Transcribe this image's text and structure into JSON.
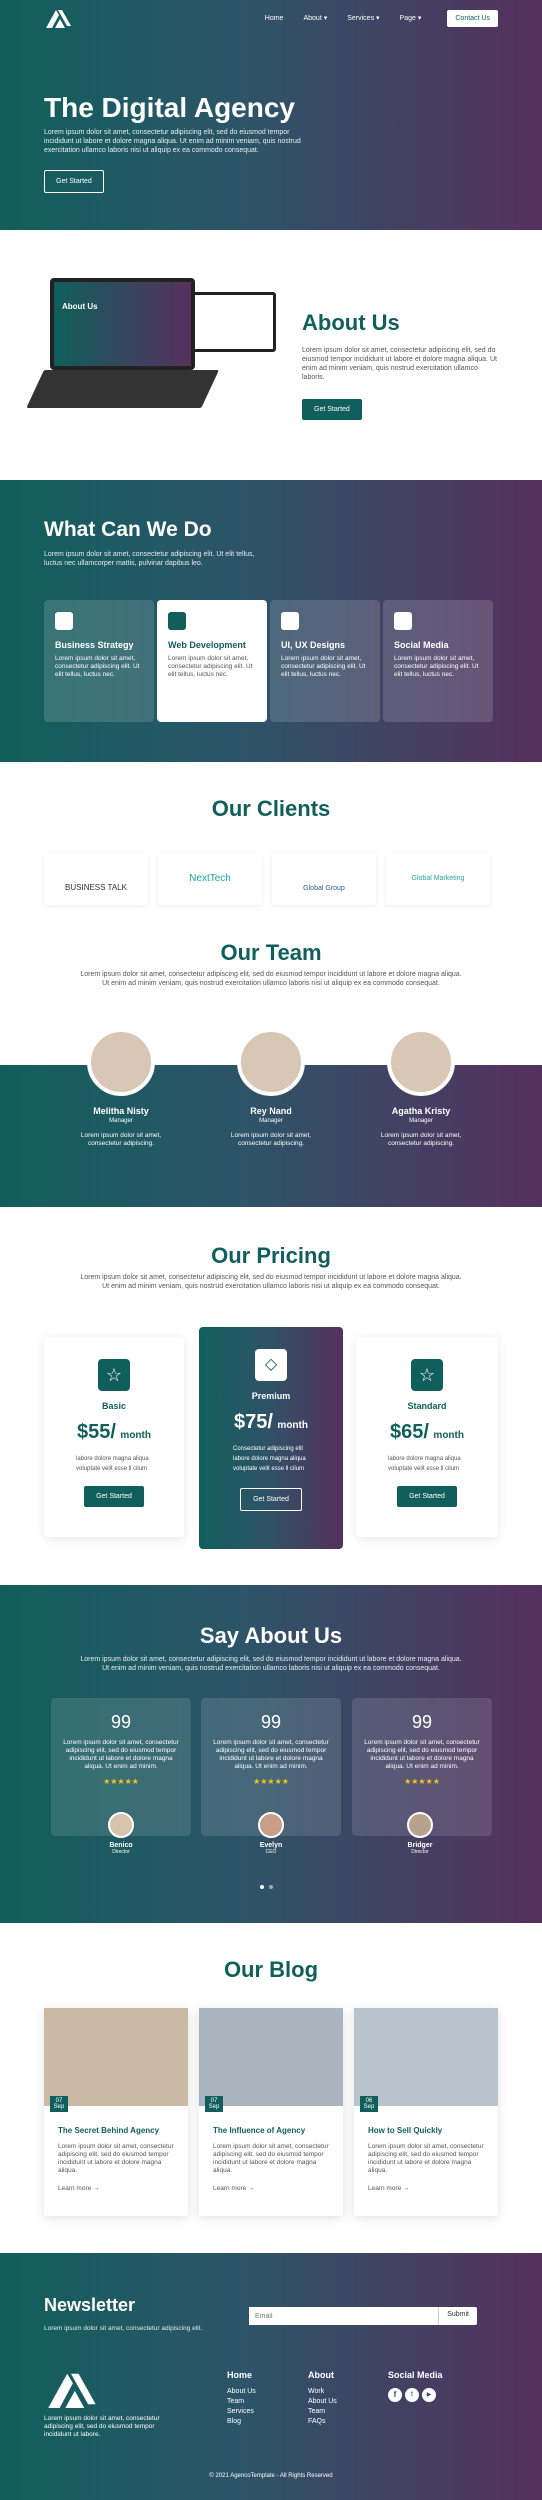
{
  "nav": {
    "items": [
      "Home",
      "About",
      "Services",
      "Page"
    ],
    "contact": "Contact Us"
  },
  "hero": {
    "title": "The Digital Agency",
    "text": "Lorem ipsum dolor sit amet, consectetur adipiscing elit, sed do eiusmod tempor incididunt ut labore et dolore magna aliqua. Ut enim ad minim veniam, quis nostrud exercitation ullamco laboris nisi ut aliquip ex ea commodo consequat.",
    "button": "Get Started"
  },
  "about": {
    "title": "About Us",
    "text": "Lorem ipsum dolor sit amet, consectetur adipiscing elit, sed do eiusmod tempor incididunt ut labore et dolore magna aliqua. Ut enim ad minim veniam, quis nostrud exercitation ullamco laboris.",
    "button": "Get Started",
    "screen_title": "About Us"
  },
  "services": {
    "title": "What Can We Do",
    "text": "Lorem ipsum dolor sit amet, consectetur adipiscing elit. Ut elit tellus, luctus nec ullamcorper mattis, pulvinar dapibus leo.",
    "cards": [
      {
        "title": "Business Strategy",
        "text": "Lorem ipsum dolor sit amet, consectetur adipiscing elit. Ut elit tellus, luctus nec."
      },
      {
        "title": "Web Development",
        "text": "Lorem ipsum dolor sit amet, consectetur adipiscing elit. Ut elit tellus, luctus nec."
      },
      {
        "title": "UI, UX Designs",
        "text": "Lorem ipsum dolor sit amet, consectetur adipiscing elit. Ut elit tellus, luctus nec."
      },
      {
        "title": "Social Media",
        "text": "Lorem ipsum dolor sit amet, consectetur adipiscing elit. Ut elit tellus, luctus nec."
      }
    ]
  },
  "clients": {
    "title": "Our Clients",
    "logos": [
      "BUSINESS TALK",
      "NextTech",
      "Global Group",
      "Global Marketing"
    ]
  },
  "team": {
    "title": "Our Team",
    "text": "Lorem ipsum dolor sit amet, consectetur adipiscing elit, sed do eiusmod tempor incididunt ut labore et dolore magna aliqua. Ut enim ad minim veniam, quis nostrud exercitation ullamco laboris nisi ut aliquip ex ea commodo consequat.",
    "members": [
      {
        "name": "Melitha Nisty",
        "role": "Manager",
        "text": "Lorem ipsum dolor sit amet, consectetur adipiscing."
      },
      {
        "name": "Rey Nand",
        "role": "Manager",
        "text": "Lorem ipsum dolor sit amet, consectetur adipiscing."
      },
      {
        "name": "Agatha Kristy",
        "role": "Manager",
        "text": "Lorem ipsum dolor sit amet, consectetur adipiscing."
      }
    ]
  },
  "pricing": {
    "title": "Our Pricing",
    "text": "Lorem ipsum dolor sit amet, consectetur adipiscing elit, sed do eiusmod tempor incididunt ut labore et dolore magna aliqua. Ut enim ad minim veniam, quis nostrud exercitation ullamco laboris nisi ut aliquip ex ea commodo consequat.",
    "plans": [
      {
        "name": "Basic",
        "price": "$55/",
        "period": "month",
        "features": [
          "labore dolore magna aliqua",
          "voluptate velit esse ll cilum"
        ],
        "button": "Get Started"
      },
      {
        "name": "Premium",
        "price": "$75/",
        "period": "month",
        "features": [
          "Consectetur adipiscing elit",
          "labore dolore magna aliqua",
          "voluptate velit esse ll cilum"
        ],
        "button": "Get Started"
      },
      {
        "name": "Standard",
        "price": "$65/",
        "period": "month",
        "features": [
          "labore dolore magna aliqua",
          "voluptate velit esse ll cilum"
        ],
        "button": "Get Started"
      }
    ]
  },
  "testimonials": {
    "title": "Say About Us",
    "text": "Lorem ipsum dolor sit amet, consectetur adipiscing elit, sed do eiusmod tempor incididunt ut labore et dolore magna aliqua. Ut enim ad minim veniam, quis nostrud exercitation ullamco laboris nisi ut aliquip ex ea commodo consequat.",
    "items": [
      {
        "quote": "Lorem ipsum dolor sit amet, consectetur adipiscing elit, sed do eiusmod tempor incididunt ut labore et dolore magna aliqua. Ut enim ad minim.",
        "name": "Benico",
        "role": "Director"
      },
      {
        "quote": "Lorem ipsum dolor sit amet, consectetur adipiscing elit, sed do eiusmod tempor incididunt ut labore et dolore magna aliqua. Ut enim ad minim.",
        "name": "Evelyn",
        "role": "CEO"
      },
      {
        "quote": "Lorem ipsum dolor sit amet, consectetur adipiscing elit, sed do eiusmod tempor incididunt ut labore et dolore magna aliqua. Ut enim ad minim.",
        "name": "Bridger",
        "role": "Director"
      }
    ],
    "stars": "★★★★★",
    "quote_mark": "99"
  },
  "blog": {
    "title": "Our Blog",
    "posts": [
      {
        "day": "07",
        "mon": "Sep",
        "title": "The Secret Behind Agency",
        "text": "Lorem ipsum dolor sit amet, consectetur adipiscing elit, sed do eiusmod tempor incididunt ut labore et dolore magna aliqua.",
        "more": "Learn more →"
      },
      {
        "day": "07",
        "mon": "Sep",
        "title": "The Influence of Agency",
        "text": "Lorem ipsum dolor sit amet, consectetur adipiscing elit, sed do eiusmod tempor incididunt ut labore et dolore magna aliqua.",
        "more": "Learn more →"
      },
      {
        "day": "06",
        "mon": "Sep",
        "title": "How to Sell Quickly",
        "text": "Lorem ipsum dolor sit amet, consectetur adipiscing elit, sed do eiusmod tempor incididunt ut labore et dolore magna aliqua.",
        "more": "Learn more →"
      }
    ]
  },
  "footer": {
    "newsletter": "Newsletter",
    "newsletter_text": "Lorem ipsum dolor sit amet, consectetur adipiscing elit.",
    "email_placeholder": "Email",
    "submit": "Submit",
    "about_text": "Lorem ipsum dolor sit amet, consectetur adipiscing elit, sed do eiusmod tempor incididunt ut labore.",
    "home": {
      "title": "Home",
      "links": [
        "About Us",
        "Team",
        "Services",
        "Blog"
      ]
    },
    "about": {
      "title": "About",
      "links": [
        "Work",
        "About Us",
        "Team",
        "FAQs"
      ]
    },
    "social": {
      "title": "Social Media"
    },
    "copyright": "© 2021 AgencoTemplate - All Rights Reserved"
  },
  "colors": {
    "teal": "#115f5c",
    "purple": "#56305e"
  }
}
